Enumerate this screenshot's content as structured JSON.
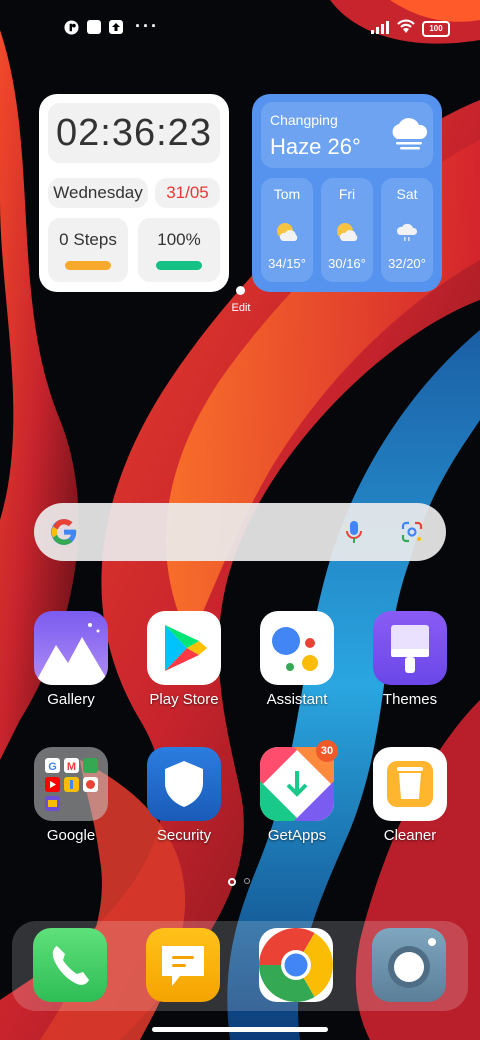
{
  "status_bar": {
    "more_glyph": "···",
    "battery": "100",
    "icons": [
      "app-notification-icon",
      "square-notification-icon",
      "upload-notification-icon",
      "signal-icon",
      "wifi-icon",
      "battery-icon"
    ]
  },
  "clock_widget": {
    "time": "02:36:23",
    "day": "Wednesday",
    "date": "31/05",
    "steps": "0 Steps",
    "battery": "100%",
    "steps_progress": 0,
    "battery_progress": 1.0,
    "colors": {
      "date": "#e53935",
      "steps_bar": "#f7a92b",
      "battery_bar": "#14c285"
    }
  },
  "weather_widget": {
    "city": "Changping",
    "condition": "Haze 26°",
    "forecast": [
      {
        "day": "Tom",
        "temp": "34/15°",
        "icon": "partly-cloudy-icon"
      },
      {
        "day": "Fri",
        "temp": "30/16°",
        "icon": "partly-cloudy-icon"
      },
      {
        "day": "Sat",
        "temp": "32/20°",
        "icon": "rain-cloud-icon"
      }
    ]
  },
  "edit_label": "Edit",
  "search": {
    "icons": [
      "google-logo-icon",
      "microphone-icon",
      "lens-icon"
    ]
  },
  "apps": [
    {
      "label": "Gallery",
      "icon": "gallery-icon"
    },
    {
      "label": "Play Store",
      "icon": "play-store-icon"
    },
    {
      "label": "Assistant",
      "icon": "assistant-icon"
    },
    {
      "label": "Themes",
      "icon": "themes-icon"
    },
    {
      "label": "Google",
      "icon": "google-folder-icon"
    },
    {
      "label": "Security",
      "icon": "security-icon"
    },
    {
      "label": "GetApps",
      "icon": "getapps-icon",
      "badge": "30"
    },
    {
      "label": "Cleaner",
      "icon": "cleaner-icon"
    }
  ],
  "page_indicator": {
    "pages": 2,
    "current": 1
  },
  "dock": [
    {
      "icon": "phone-icon"
    },
    {
      "icon": "messages-icon"
    },
    {
      "icon": "chrome-icon"
    },
    {
      "icon": "camera-icon"
    }
  ]
}
